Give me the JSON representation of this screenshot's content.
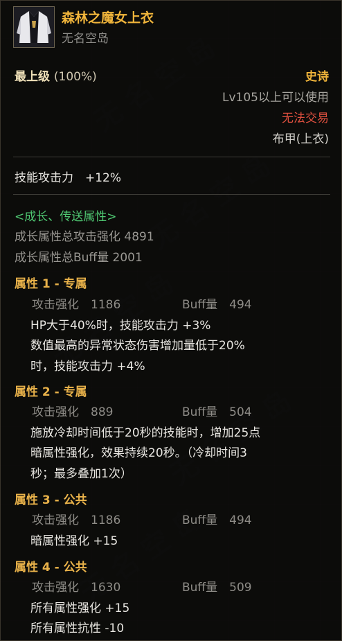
{
  "item": {
    "name": "森林之魔女上衣",
    "subtitle": "无名空岛",
    "icon": "white-coat-armor-icon",
    "grade": "最上级",
    "grade_pct": "(100%)",
    "rarity": "史诗",
    "level_req": "Lv105以上可以使用",
    "trade": "无法交易",
    "slot": "布甲(上衣)"
  },
  "base": {
    "skill_attack": "技能攻击力　+12%"
  },
  "growth": {
    "header": "<成长、传送属性>",
    "total_attack": "成长属性总攻击强化 4891",
    "total_buff": "成长属性总Buff量 2001"
  },
  "attributes": [
    {
      "header": "属性 1 - 专属",
      "attack": "攻击强化　1186",
      "buff": "Buff量　494",
      "lines": [
        "HP大于40%时，技能攻击力 +3%",
        "数值最高的异常状态伤害增加量低于20%",
        "时，技能攻击力 +4%"
      ]
    },
    {
      "header": "属性 2 - 专属",
      "attack": "攻击强化　889",
      "buff": "Buff量　504",
      "lines": [
        "施放冷却时间低于20秒的技能时，增加25点",
        "暗属性强化，效果持续20秒。（冷却时间3",
        "秒；最多叠加1次）"
      ]
    },
    {
      "header": "属性 3 - 公共",
      "attack": "攻击强化　1186",
      "buff": "Buff量　494",
      "lines": [
        "暗属性强化 +15"
      ]
    },
    {
      "header": "属性 4 - 公共",
      "attack": "攻击强化　1630",
      "buff": "Buff量　509",
      "lines": [
        "所有属性强化 +15",
        "所有属性抗性 -10"
      ]
    }
  ],
  "colors": {
    "title": "#f1b53b",
    "rarity": "#f1b53b",
    "trade": "#e0503f",
    "growth_header": "#4fc872",
    "attr_header": "#e9b24a"
  }
}
